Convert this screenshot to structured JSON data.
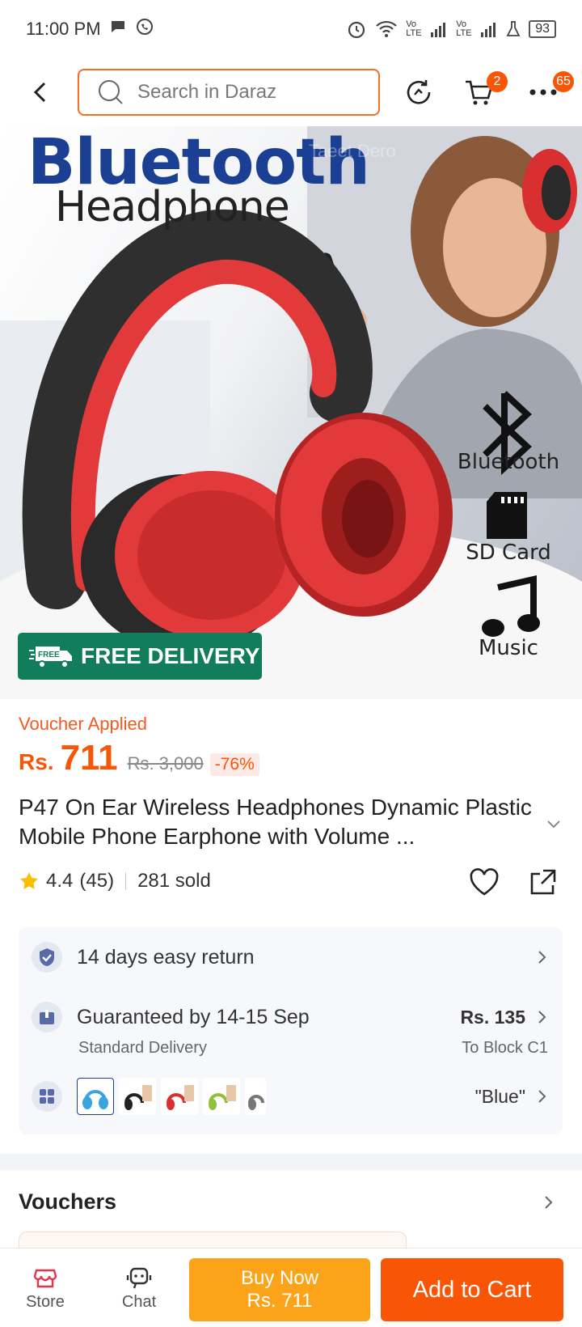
{
  "status_bar": {
    "time": "11:00 PM",
    "battery": "93",
    "lte1": "Vo LTE",
    "lte2": "Vo LTE"
  },
  "header": {
    "search_placeholder": "Search in Daraz",
    "cart_badge": "2",
    "more_badge": "65"
  },
  "hero": {
    "title_line1": "Bluetooth",
    "title_line2": "Headphone",
    "watermark": "Taeet Dero",
    "features": [
      "Bluetooth",
      "SD Card",
      "Music"
    ],
    "free_delivery_tag": "FREE",
    "free_delivery_label": "FREE DELIVERY",
    "headphone_color": "#e63a3a"
  },
  "product": {
    "voucher_applied": "Voucher Applied",
    "currency": "Rs.",
    "price": "711",
    "original_price": "Rs. 3,000",
    "discount": "-76%",
    "title": "P47 On Ear Wireless Headphones Dynamic Plastic Mobile Phone Earphone with Volume ...",
    "rating": "4.4",
    "reviews": "(45)",
    "sold": "281 sold"
  },
  "info": {
    "return_policy": "14 days easy return",
    "guarantee": "Guaranteed by 14-15 Sep",
    "delivery_type": "Standard Delivery",
    "delivery_price": "Rs. 135",
    "delivery_to": "To Block C1",
    "selected_variant": "\"Blue\"",
    "variant_colors": [
      "#3aa4e0",
      "#222222",
      "#d83030",
      "#8fc23a",
      "#777777"
    ]
  },
  "vouchers": {
    "title": "Vouchers"
  },
  "bottom_bar": {
    "store_label": "Store",
    "chat_label": "Chat",
    "buy_now_label": "Buy Now",
    "buy_now_price": "Rs. 711",
    "add_to_cart_label": "Add to Cart"
  },
  "colors": {
    "brand_orange": "#f85606",
    "buy_now_yellow": "#fca419",
    "price_orange": "#f85606",
    "free_delivery_green": "#127d5a"
  }
}
